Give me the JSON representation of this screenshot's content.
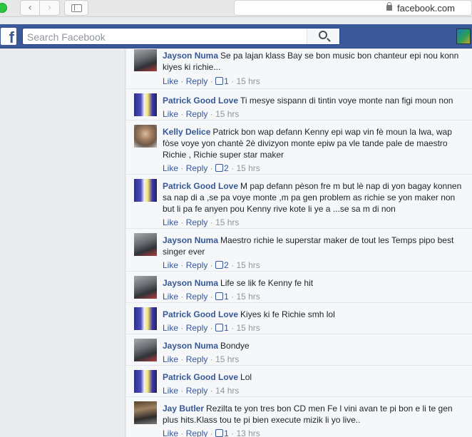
{
  "browser": {
    "url": "facebook.com",
    "back_glyph": "‹",
    "forward_glyph": "›"
  },
  "fb": {
    "logo": "f",
    "search_placeholder": "Search Facebook"
  },
  "actions": {
    "like": "Like",
    "reply": "Reply",
    "sep": "·"
  },
  "comments": [
    {
      "author": "Jayson Numa",
      "text": "Se pa lajan klass Bay se bon music bon chanteur epi nou konn kiyes ki richie...",
      "likes": "1",
      "time": "15 hrs",
      "avatar": "jayson"
    },
    {
      "author": "Patrick Good Love",
      "text": "Ti mesye sispann di tintin voye monte nan figi moun non",
      "likes": "",
      "time": "15 hrs",
      "avatar": "patrick"
    },
    {
      "author": "Kelly Delice",
      "text": "Patrick bon wap defann Kenny epi wap vin fè moun la lwa, wap fòse voye yon chantè 2è divizyon monte epiw pa vle tande pale de maestro Richie , Richie super star maker",
      "likes": "2",
      "time": "15 hrs",
      "avatar": "kelly"
    },
    {
      "author": "Patrick Good Love",
      "text": "M pap defann pèson fre m but lè nap di yon bagay konnen sa nap di a ,se pa voye monte ,m pa gen problem as richie se yon maker non but li pa fe anyen pou Kenny rive kote li ye a ...se sa m di non",
      "likes": "",
      "time": "15 hrs",
      "avatar": "patrick"
    },
    {
      "author": "Jayson Numa",
      "text": "Maestro richie le superstar maker de tout les Temps pipo best singer ever",
      "likes": "2",
      "time": "15 hrs",
      "avatar": "jayson"
    },
    {
      "author": "Jayson Numa",
      "text": "Life se lik fe Kenny fe hit",
      "likes": "1",
      "time": "15 hrs",
      "avatar": "jayson"
    },
    {
      "author": "Patrick Good Love",
      "text": "Kiyes ki fe Richie smh lol",
      "likes": "1",
      "time": "15 hrs",
      "avatar": "patrick"
    },
    {
      "author": "Jayson Numa",
      "text": "Bondye",
      "likes": "",
      "time": "15 hrs",
      "avatar": "jayson"
    },
    {
      "author": "Patrick Good Love",
      "text": "Lol",
      "likes": "",
      "time": "14 hrs",
      "avatar": "patrick"
    },
    {
      "author": "Jay Butler",
      "text": "Rezilta te yon tres bon CD men Fe l vini avan te pi bon e li te gen plus hits.Klass tou te pi bien execute mizik li yo live..",
      "likes": "1",
      "time": "13 hrs",
      "avatar": "jaybutler"
    }
  ]
}
